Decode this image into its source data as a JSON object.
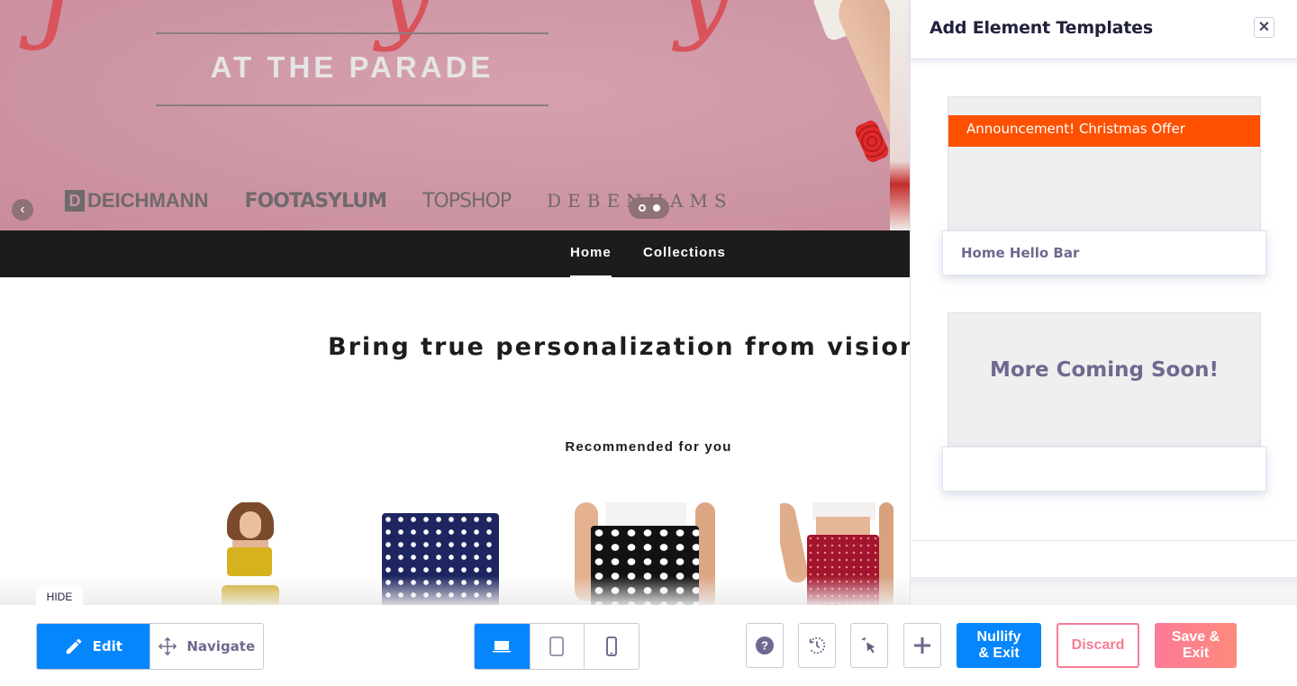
{
  "hero": {
    "script_text": "Pretty",
    "subtitle": "AT THE PARADE",
    "brands": [
      "DEICHMANN",
      "FOOTASYLUM",
      "TOPSHOP",
      "DEBENHAMS"
    ],
    "brand_d_letter": "D",
    "prev_icon": "‹",
    "slides_total": 2,
    "active_slide": 2
  },
  "nav": {
    "items": [
      {
        "label": "Home",
        "active": true
      },
      {
        "label": "Collections",
        "active": false
      }
    ]
  },
  "content": {
    "headline": "Bring true personalization from vision to reality",
    "recommended_title": "Recommended for you",
    "products": [
      {
        "name": "yellow-polka-dot-set"
      },
      {
        "name": "navy-polka-dot-skirt"
      },
      {
        "name": "black-polka-dot-skirt"
      },
      {
        "name": "red-wrap-skirt"
      }
    ]
  },
  "panel": {
    "title": "Add Element Templates",
    "close_icon": "✕",
    "templates": [
      {
        "preview_text": "Announcement! Christmas Offer",
        "preview_color": "#fd5101",
        "label": "Home Hello Bar"
      },
      {
        "preview_text": "More Coming Soon!",
        "label": ""
      }
    ]
  },
  "toolbar": {
    "hide_label": "HIDE",
    "mode": {
      "edit_label": "Edit",
      "navigate_label": "Navigate",
      "active": "edit"
    },
    "device": {
      "options": [
        "desktop",
        "tablet",
        "mobile"
      ],
      "active": "desktop"
    },
    "icons": [
      "help-icon",
      "history-icon",
      "element-select-icon",
      "add-icon"
    ],
    "nullify_label_1": "Nullify",
    "nullify_label_2": "& Exit",
    "discard_label": "Discard",
    "save_label_1": "Save &",
    "save_label_2": "Exit",
    "colors": {
      "primary": "#0586fd",
      "danger": "#f67d94",
      "accent": "#fd5101"
    }
  }
}
